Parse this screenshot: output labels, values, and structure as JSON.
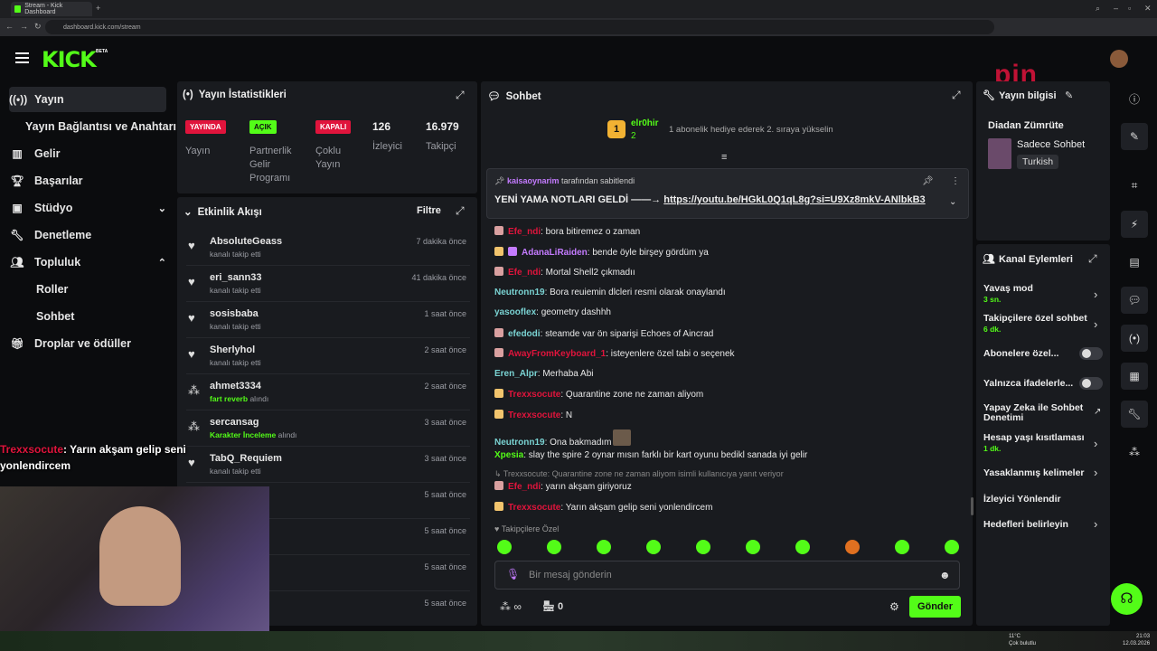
{
  "browser": {
    "tab_title": "Stream - Kick Dashboard",
    "url": "dashboard.kick.com/stream"
  },
  "header": {
    "logo": "KICK",
    "beta": "BETA"
  },
  "sidebar": {
    "items": [
      {
        "label": "Yayın",
        "icon": "broadcast-icon"
      },
      {
        "label": "Yayın Bağlantısı ve Anahtarı"
      },
      {
        "label": "Gelir",
        "icon": "chart-icon"
      },
      {
        "label": "Başarılar",
        "icon": "trophy-icon"
      },
      {
        "label": "Stüdyo",
        "icon": "studio-icon"
      },
      {
        "label": "Denetleme",
        "icon": "wrench-icon"
      },
      {
        "label": "Topluluk",
        "icon": "users-icon"
      },
      {
        "label": "Roller"
      },
      {
        "label": "Sohbet"
      },
      {
        "label": "Droplar ve ödüller",
        "icon": "gift-icon"
      }
    ]
  },
  "stats": {
    "title": "Yayın İstatistikleri",
    "items": [
      {
        "badge": "YAYINDA",
        "label": "Yayın",
        "color": "#e0143c"
      },
      {
        "badge": "AÇIK",
        "label": "Partnerlik Gelir Programı",
        "color": "#53fc18"
      },
      {
        "badge": "KAPALI",
        "label": "Çoklu Yayın",
        "color": "#e0143c"
      },
      {
        "value": "126",
        "label": "İzleyici"
      },
      {
        "value": "16.979",
        "label": "Takipçi"
      }
    ]
  },
  "activity": {
    "title": "Etkinlik Akışı",
    "filter": "Filtre",
    "items": [
      {
        "name": "AbsoluteGeass",
        "desc": "kanalı takip etti",
        "time": "7 dakika önce"
      },
      {
        "name": "eri_sann33",
        "desc": "kanalı takip etti",
        "time": "41 dakika önce"
      },
      {
        "name": "sosisbaba",
        "desc": "kanalı takip etti",
        "time": "1 saat önce"
      },
      {
        "name": "Sherlyhol",
        "desc": "kanalı takip etti",
        "time": "2 saat önce"
      },
      {
        "name": "ahmet3334",
        "reward": "fart reverb",
        "desc": "alındı",
        "time": "2 saat önce"
      },
      {
        "name": "sercansag",
        "reward": "Karakter İnceleme",
        "desc": "alındı",
        "time": "3 saat önce"
      },
      {
        "name": "TabQ_Requiem",
        "desc": "kanalı takip etti",
        "time": "3 saat önce"
      },
      {
        "time": "5 saat önce"
      },
      {
        "time": "5 saat önce"
      },
      {
        "time": "5 saat önce"
      },
      {
        "time": "5 saat önce"
      }
    ]
  },
  "overlay": {
    "user": "Trexxsocute",
    "text": ": Yarın akşam gelip seni",
    "text2": "yonlendircem"
  },
  "chat": {
    "title": "Sohbet",
    "top_user": "elr0hir",
    "top_count": "2",
    "top_rank": "1",
    "top_msg": "1 abonelik hediye ederek 2. sıraya yükselin",
    "pinned_by": "kaisaoynarim",
    "pinned_suffix": "tarafından sabitlendi",
    "pinned_text": "YENİ YAMA NOTLARI GELDİ ——→",
    "pinned_link": "https://youtu.be/HGkL0Q1qL8g?si=U9Xz8mkV-ANlbkB3",
    "messages": [
      {
        "user": "Efe_ndi",
        "color": "#e0143c",
        "badge": "#d9a0a0",
        "text": ": bora bitiremez o zaman"
      },
      {
        "user": "AdanaLiRaiden",
        "color": "#c47bff",
        "badge": "#c47bff",
        "text": ": bende öyle birşey gördüm ya"
      },
      {
        "user": "Efe_ndi",
        "color": "#e0143c",
        "badge": "#d9a0a0",
        "text": ": Mortal Shell2 çıkmadıı"
      },
      {
        "user": "Neutronn19",
        "color": "#7ad3d3",
        "badge": "",
        "text": ": Bora reuiemin dlcleri resmi olarak onaylandı"
      },
      {
        "user": "yasooflex",
        "color": "#7ad3d3",
        "badge": "",
        "text": ": geometry dashhh"
      },
      {
        "user": "efedodi",
        "color": "#7ad3d3",
        "badge": "#d9a0a0",
        "text": ": steamde var ön siparişi Echoes of Aincrad"
      },
      {
        "user": "AwayFromKeyboard_1",
        "color": "#e0143c",
        "badge": "#d9a0a0",
        "text": ": isteyenlere özel tabi o seçenek"
      },
      {
        "user": "Eren_Alpr",
        "color": "#7ad3d3",
        "badge": "",
        "text": ": Merhaba Abi"
      },
      {
        "user": "Trexxsocute",
        "color": "#e0143c",
        "badge": "#f2c46d",
        "text": ": Quarantine zone ne zaman aliyom"
      },
      {
        "user": "Trexxsocute",
        "color": "#e0143c",
        "badge": "#f2c46d",
        "text": ": N"
      },
      {
        "user": "Neutronn19",
        "color": "#7ad3d3",
        "badge": "",
        "text": ": Ona bakmadım"
      },
      {
        "user": "Xpesia",
        "color": "#53fc18",
        "badge": "",
        "text": ": slay the spire 2 oynar mısın farklı bir kart oyunu bedikl sanada iyi gelir"
      },
      {
        "user": "Efe_ndi",
        "color": "#e0143c",
        "badge": "#d9a0a0",
        "text": ": yarın akşam giriyoruz"
      },
      {
        "user": "Trexxsocute",
        "color": "#e0143c",
        "badge": "#f2c46d",
        "text": ": Yarın akşam gelip seni yonlendircem"
      }
    ],
    "reply_note": "Trexxsocute: Quarantine zone ne zaman aliyom isimli kullanıcıya yanıt veriyor",
    "followers_only": "Takipçilere Özel",
    "input_placeholder": "Bir mesaj gönderin",
    "points": "∞",
    "shop_count": "0",
    "send": "Gönder"
  },
  "info": {
    "title": "Yayın bilgisi",
    "category": "Diadan Zümrüte",
    "tag1": "Sadece Sohbet",
    "tag2": "Turkish"
  },
  "actions": {
    "title": "Kanal Eylemleri",
    "items": [
      {
        "label": "Yavaş mod",
        "sub": "3 sn."
      },
      {
        "label": "Takipçilere özel sohbet",
        "sub": "6 dk."
      },
      {
        "label": "Abonelere özel..."
      },
      {
        "label": "Yalnızca ifadelerle..."
      },
      {
        "label": "Yapay Zeka ile Sohbet Denetimi"
      },
      {
        "label": "Hesap yaşı kısıtlaması",
        "sub": "1 dk."
      },
      {
        "label": "Yasaklanmış kelimeler"
      },
      {
        "label": "İzleyici Yönlendir"
      },
      {
        "label": "Hedefleri belirleyin"
      }
    ]
  },
  "taskbar": {
    "weather": "11°C",
    "weather_desc": "Çok bulutlu",
    "time": "21:03",
    "date": "12.03.2026"
  }
}
